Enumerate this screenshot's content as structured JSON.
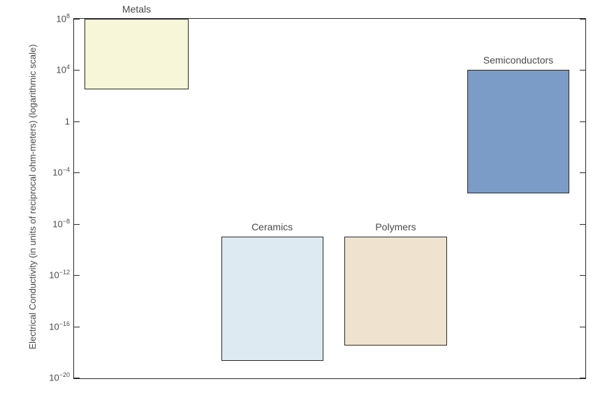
{
  "chart_data": {
    "type": "bar",
    "ylabel": "Electrical Conductivity (in units of reciprocal ohm-meters) (logarithmic scale)",
    "xlabel": "",
    "title": "",
    "categories": [
      "Metals",
      "Ceramics",
      "Polymers",
      "Semiconductors"
    ],
    "values": [
      {
        "name": "Metals",
        "min_exp": 2.5,
        "max_exp": 8
      },
      {
        "name": "Ceramics",
        "min_exp": -18.7,
        "max_exp": -9
      },
      {
        "name": "Polymers",
        "min_exp": -17.5,
        "max_exp": -9
      },
      {
        "name": "Semiconductors",
        "min_exp": -5.6,
        "max_exp": 4
      }
    ],
    "ylim_exponent": [
      -20,
      8
    ],
    "y_ticks": [
      {
        "exponent": 8,
        "display_base": "10",
        "display_exp": "8"
      },
      {
        "exponent": 4,
        "display_base": "10",
        "display_exp": "4"
      },
      {
        "exponent": 0,
        "display_base": "1",
        "display_exp": ""
      },
      {
        "exponent": -4,
        "display_base": "10",
        "display_exp": "−4"
      },
      {
        "exponent": -8,
        "display_base": "10",
        "display_exp": "−8"
      },
      {
        "exponent": -12,
        "display_base": "10",
        "display_exp": "−12"
      },
      {
        "exponent": -16,
        "display_base": "10",
        "display_exp": "−16"
      },
      {
        "exponent": -20,
        "display_base": "10",
        "display_exp": "−20"
      }
    ],
    "layout": {
      "block_x": [
        {
          "name": "Metals",
          "left_frac": 0.02,
          "width_frac": 0.205,
          "label_above": true
        },
        {
          "name": "Ceramics",
          "left_frac": 0.288,
          "width_frac": 0.2,
          "label_above": true
        },
        {
          "name": "Polymers",
          "left_frac": 0.53,
          "width_frac": 0.2,
          "label_above": true
        },
        {
          "name": "Semiconductors",
          "left_frac": 0.77,
          "width_frac": 0.2,
          "label_above": true
        }
      ],
      "colors": {
        "Metals": "#f7f6d9",
        "Ceramics": "#deeaf1",
        "Polymers": "#efe3cf",
        "Semiconductors": "#7a9cc6"
      }
    }
  }
}
